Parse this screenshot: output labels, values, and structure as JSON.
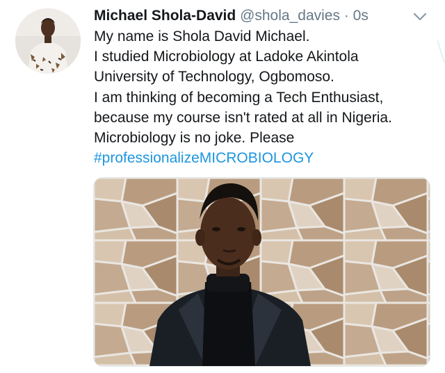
{
  "tweet": {
    "author_name": "Michael Shola-David",
    "author_handle": "@shola_davies",
    "separator": "·",
    "timestamp": "0s",
    "avatar_icon": "user-avatar-photo",
    "menu_icon": "chevron-down-icon",
    "text_lines": [
      "My name is Shola David Michael.",
      "I studied Microbiology at Ladoke Akintola",
      "University of Technology, Ogbomoso.",
      "I am thinking of becoming a Tech Enthusiast,",
      "because my course isn't rated at all in Nigeria.",
      "Microbiology is no joke. Please"
    ],
    "hashtag": "#professionalizeMICROBIOLOGY",
    "media_icon": "attached-photo"
  },
  "colors": {
    "text": "#14171a",
    "muted": "#657786",
    "link": "#1b95e0",
    "border": "#e1e8ed"
  }
}
